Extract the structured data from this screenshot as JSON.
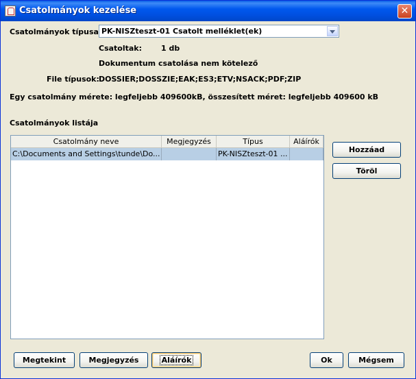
{
  "window": {
    "title": "Csatolmányok kezelése",
    "close_glyph": "✕"
  },
  "form": {
    "type_label": "Csatolmányok típusa:",
    "type_value": "PK-NISZteszt-01 Csatolt melléklet(ek)",
    "attached_label": "Csatoltak:",
    "attached_value": "1 db",
    "optional_note": "Dokumentum csatolása nem kötelező",
    "filetypes_label": "File típusok:",
    "filetypes_value": "DOSSIER;DOSSZIE;EAK;ES3;ETV;NSACK;PDF;ZIP",
    "size_note": "Egy csatolmány mérete: legfeljebb 409600kB, összesített méret: legfeljebb 409600 kB",
    "list_title": "Csatolmányok listája"
  },
  "table": {
    "columns": [
      "Csatolmány neve",
      "Megjegyzés",
      "Típus",
      "Aláírók"
    ],
    "rows": [
      [
        "C:\\Documents and Settings\\tunde\\Do...",
        "",
        "PK-NISZteszt-01 ...",
        ""
      ]
    ]
  },
  "side_buttons": {
    "add": "Hozzáad",
    "remove": "Töröl"
  },
  "bottom_buttons": {
    "view": "Megtekint",
    "note": "Megjegyzés",
    "signers": "Aláírók",
    "ok": "Ok",
    "cancel": "Mégsem"
  },
  "icons": {
    "title": "java-app-icon",
    "combo": "chevron-down-icon",
    "close": "close-icon"
  },
  "colors": {
    "titlebar": "#0058ee",
    "selection": "#b8cfe5",
    "window_bg": "#ece9d8"
  }
}
